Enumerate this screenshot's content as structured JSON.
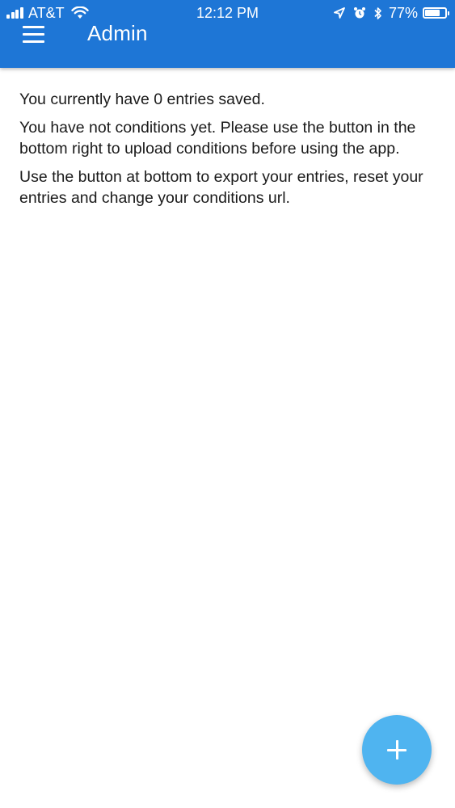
{
  "status_bar": {
    "carrier": "AT&T",
    "time": "12:12 PM",
    "battery_percent": "77%",
    "battery_level": 0.77,
    "icons": [
      "signal-icon",
      "wifi-icon",
      "location-icon",
      "alarm-icon",
      "bluetooth-icon",
      "battery-icon"
    ]
  },
  "header": {
    "title": "Admin",
    "menu_icon": "hamburger-menu-icon",
    "color": "#1e76d6"
  },
  "content": {
    "paragraphs": [
      "You currently have 0 entries saved.",
      "You have not conditions yet. Please use the button in the bottom right to upload conditions before using the app.",
      "Use the button at bottom to export your entries, reset your entries and change your conditions url."
    ]
  },
  "fab": {
    "icon": "plus-icon",
    "color": "#4fb4f0"
  }
}
